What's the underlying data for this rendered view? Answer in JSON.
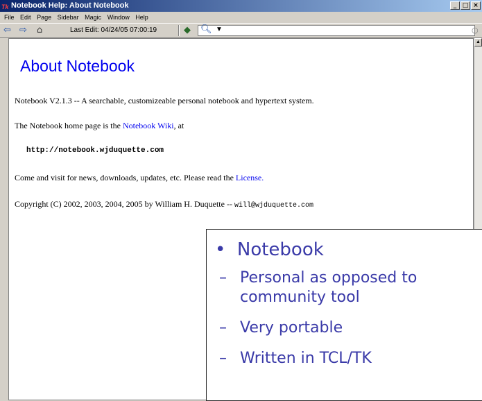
{
  "window": {
    "title": "Notebook Help: About Notebook",
    "app_icon": "Tk",
    "minimize": "_",
    "maximize": "□",
    "close": "×"
  },
  "menu": [
    "File",
    "Edit",
    "Page",
    "Sidebar",
    "Magic",
    "Window",
    "Help"
  ],
  "toolbar": {
    "back_icon": "arrow-left-icon",
    "forward_icon": "arrow-right-icon",
    "home_icon": "home-icon",
    "last_edit": "Last Edit: 04/24/05 07:00:19",
    "index_icon": "book-icon",
    "search_icon": "magnifier-icon",
    "search_value": ""
  },
  "page": {
    "heading": "About Notebook",
    "line1": "Notebook V2.1.3 -- A searchable, customizeable personal notebook and hypertext system.",
    "line2_pre": "The Notebook home page is the ",
    "line2_link": "Notebook Wiki",
    "line2_post": ", at",
    "url": "http://notebook.wjduquette.com",
    "line3_pre": "Come and visit for news, downloads, updates, etc. Please read the ",
    "line3_link": "License.",
    "line4_pre": "Copyright (C) 2002, 2003, 2004, 2005 by William H. Duquette -- ",
    "line4_email": "will@wjduquette.com"
  },
  "overlay": {
    "bullet": "•",
    "title": "Notebook",
    "items": [
      "Personal as opposed to",
      "community tool",
      "Very portable",
      "Written in TCL/TK"
    ],
    "dash": "–"
  }
}
